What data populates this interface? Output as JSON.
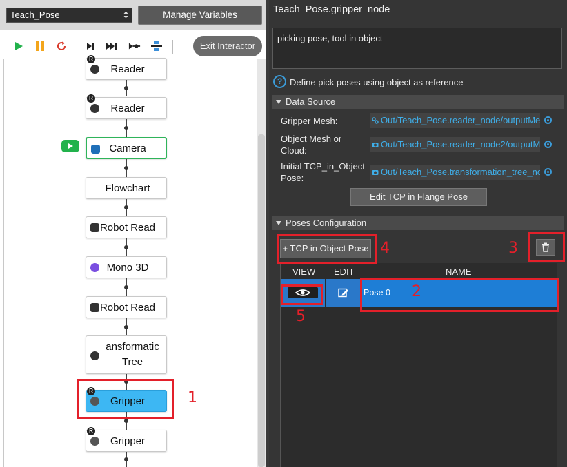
{
  "left_panel": {
    "flow_selector": {
      "value": "Teach_Pose"
    },
    "manage_variables_label": "Manage Variables",
    "exit_interactor_label": "Exit Interactor",
    "nodes": [
      {
        "label": "Reader"
      },
      {
        "label": "Reader"
      },
      {
        "label": "Camera"
      },
      {
        "label": "Flowchart"
      },
      {
        "label": "Robot Read"
      },
      {
        "label": "Mono 3D"
      },
      {
        "label": "Robot Read"
      },
      {
        "label": "ansformatic Tree"
      },
      {
        "label": "Gripper"
      },
      {
        "label": "Gripper"
      }
    ],
    "badge_letter": "R"
  },
  "right_panel": {
    "title": "Teach_Pose.gripper_node",
    "description": "picking pose, tool in object",
    "help_text": "Define pick poses using object as reference",
    "data_source": {
      "header": "Data Source",
      "fields": [
        {
          "label": "Gripper Mesh:",
          "value": "Out/Teach_Pose.reader_node/outputMe"
        },
        {
          "label": "Object Mesh or Cloud:",
          "value": "Out/Teach_Pose.reader_node2/outputM"
        },
        {
          "label": "Initial TCP_in_Object Pose:",
          "value": "Out/Teach_Pose.transformation_tree_no"
        }
      ],
      "edit_tcp_label": "Edit TCP in Flange Pose"
    },
    "poses_configuration": {
      "header": "Poses Configuration",
      "add_pose_label": "+ TCP in Object Pose",
      "columns": {
        "view": "VIEW",
        "edit": "EDIT",
        "name": "NAME"
      },
      "rows": [
        {
          "name": "Pose 0"
        }
      ]
    }
  },
  "annotations": [
    "1",
    "2",
    "3",
    "4",
    "5"
  ],
  "colors": {
    "highlight": "#e3202a",
    "selected_node": "#3db7f3",
    "camera_border": "#2fb45a",
    "link_blue": "#3faee8",
    "row_selected": "#1e7ed6"
  },
  "icons": [
    "play-icon",
    "pause-icon",
    "restart-icon",
    "step-icon",
    "fast-forward-icon",
    "breakpoint-icon",
    "debug-icon",
    "help-icon",
    "eye-icon",
    "edit-icon",
    "trash-icon",
    "mesh-icon",
    "camera-icon"
  ]
}
